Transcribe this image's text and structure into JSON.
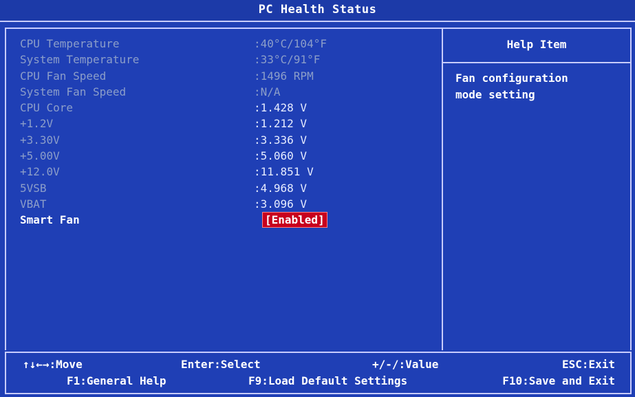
{
  "title": "PC Health Status",
  "rows": [
    {
      "label": "CPU Temperature",
      "value": ":40°C/104°F"
    },
    {
      "label": "System Temperature",
      "value": ":33°C/91°F"
    },
    {
      "label": "CPU Fan Speed",
      "value": ":1496 RPM"
    },
    {
      "label": "System Fan Speed",
      "value": ":N/A"
    },
    {
      "label": "CPU Core",
      "value": ":1.428 V"
    },
    {
      "label": "+1.2V",
      "value": ":1.212 V"
    },
    {
      "label": "+3.30V",
      "value": ":3.336 V"
    },
    {
      "label": "+5.00V",
      "value": ":5.060 V"
    },
    {
      "label": "+12.0V",
      "value": ":11.851 V"
    },
    {
      "label": "5VSB",
      "value": ":4.968 V"
    },
    {
      "label": "VBAT",
      "value": ":3.096 V"
    }
  ],
  "smart_fan": {
    "label": "Smart Fan",
    "value": "[Enabled]"
  },
  "help": {
    "header": "Help Item",
    "text": "Fan configuration\nmode setting"
  },
  "footer": {
    "move": "↑↓←→:Move",
    "select": "Enter:Select",
    "value": "+/-/:Value",
    "exit": "ESC:Exit",
    "general_help": "F1:General Help",
    "load_defaults": "F9:Load Default Settings",
    "save_exit": "F10:Save and Exit"
  },
  "colors": {
    "background": "#1f3fb5",
    "highlight": "#c8001e",
    "border": "#c8ccff"
  }
}
